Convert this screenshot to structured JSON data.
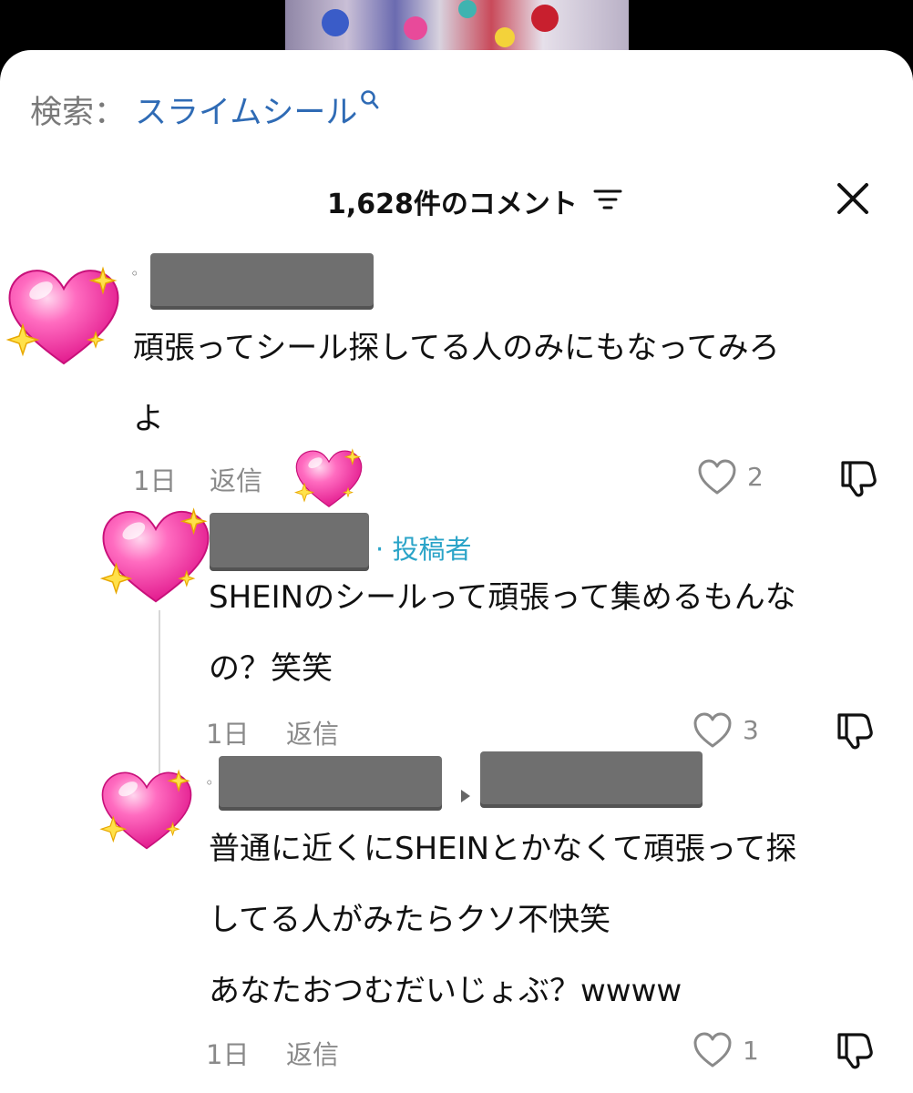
{
  "search": {
    "label": "検索：",
    "term": "スライムシール"
  },
  "header": {
    "comment_count": "1,628件のコメント"
  },
  "comments": [
    {
      "text_lines": [
        "頑張ってシール探してる人のみにもなってみろ",
        "よ"
      ],
      "time": "1日",
      "reply_label": "返信",
      "likes": "2"
    },
    {
      "author_tag": "投稿者",
      "text_lines": [
        "SHEINのシールって頑張って集めるもんな",
        "の？笑笑"
      ],
      "time": "1日",
      "reply_label": "返信",
      "likes": "3"
    },
    {
      "text_lines": [
        "普通に近くにSHEINとかなくて頑張って探",
        "してる人がみたらクソ不快笑",
        "あなたおつむだいじょぶ？wwww"
      ],
      "time": "1日",
      "reply_label": "返信",
      "likes": "1"
    }
  ],
  "colors": {
    "search_term": "#2f6bb5",
    "author_tag": "#2ba4c8",
    "redaction": "#6f6f6f",
    "heart_emoji": "#ff4fa8"
  },
  "icons": [
    "search-icon",
    "sort-icon",
    "close-icon",
    "heart-outline-icon",
    "dislike-icon",
    "sparkling-heart-emoji"
  ]
}
